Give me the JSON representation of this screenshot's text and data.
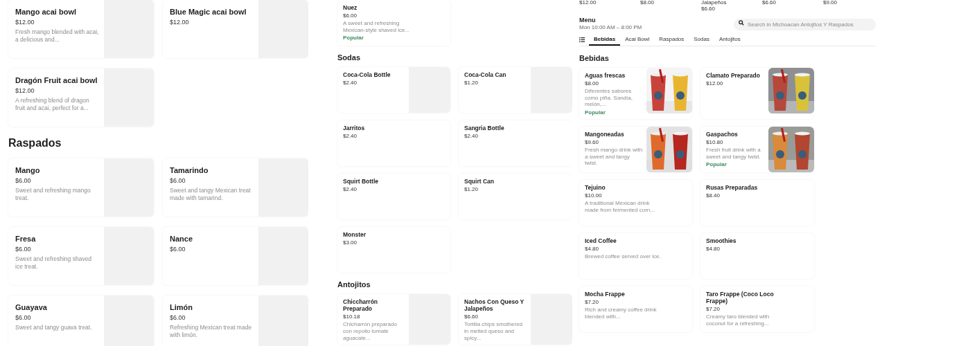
{
  "panels": [
    {
      "sections": [
        {
          "items": [
            {
              "kind": "placeholder",
              "name": "Mango acai bowl",
              "price": "$12.00",
              "description": "Fresh mango blended with acai, a delicious and..."
            },
            {
              "kind": "placeholder",
              "name": "Blue Magic acai bowl",
              "price": "$12.00"
            },
            {
              "kind": "placeholder",
              "name": "Dragón Fruit acai bowl",
              "price": "$12.00",
              "description": "A refreshing blend of dragon fruit and acai, perfect for a..."
            }
          ]
        },
        {
          "heading": "Raspados",
          "items": [
            {
              "kind": "placeholder",
              "name": "Mango",
              "price": "$6.00",
              "description": "Sweet and refreshing mango treat."
            },
            {
              "kind": "placeholder",
              "name": "Tamarindo",
              "price": "$6.00",
              "description": "Sweet and tangy Mexican treat made with tamarind."
            },
            {
              "kind": "placeholder",
              "name": "Fresa",
              "price": "$6.00",
              "description": "Sweet and refreshing shaved ice treat."
            },
            {
              "kind": "placeholder",
              "name": "Nance",
              "price": "$6.00"
            },
            {
              "kind": "placeholder",
              "name": "Guayava",
              "price": "$6.00",
              "description": "Sweet and tangy guava treat."
            },
            {
              "kind": "placeholder",
              "name": "Limón",
              "price": "$6.00",
              "description": "Refreshing Mexican treat made with limón."
            }
          ]
        }
      ]
    },
    {
      "sections": [
        {
          "items": [
            {
              "kind": "plain",
              "name": "Nuez",
              "price": "$6.00",
              "description": "A sweet and refreshing Mexican-style shaved ice...",
              "badge": "Popular"
            }
          ]
        },
        {
          "heading": "Sodas",
          "items": [
            {
              "kind": "placeholder",
              "name": "Coca-Cola Bottle",
              "price": "$2.40"
            },
            {
              "kind": "placeholder",
              "name": "Coca-Cola Can",
              "price": "$1.20"
            },
            {
              "kind": "plain",
              "name": "Jarritos",
              "price": "$2.40"
            },
            {
              "kind": "plain",
              "name": "Sangria Bottle",
              "price": "$2.40"
            },
            {
              "kind": "plain",
              "name": "Squirt Bottle",
              "price": "$2.40"
            },
            {
              "kind": "plain",
              "name": "Squirt Can",
              "price": "$1.20"
            },
            {
              "kind": "plain",
              "name": "Monster",
              "price": "$3.00"
            }
          ]
        },
        {
          "heading": "Antojitos",
          "items": [
            {
              "kind": "placeholder",
              "name": "Chiccharrón Preparado",
              "price": "$10.18",
              "description": "Chicharrón preparado con repollo tomate aguacate..."
            },
            {
              "kind": "placeholder",
              "name": "Nachos Con Queso Y Jalapeños",
              "price": "$6.60",
              "description": "Tortilla chips smothered in melted queso and spicy..."
            }
          ]
        }
      ]
    },
    {
      "top_strip": [
        [
          "$12.00"
        ],
        [
          "$8.00"
        ],
        [
          "Jalapeños",
          "$6.60"
        ],
        [
          "$6.60"
        ],
        [
          "$9.00"
        ]
      ],
      "menu": {
        "title": "Menu",
        "hours": "Mon 10:00 AM – 8:00 PM"
      },
      "search": {
        "placeholder": "Search in Michoacan Antojitos Y Raspados"
      },
      "tabs": [
        {
          "label": "Bebidas",
          "selected": true
        },
        {
          "label": "Acai Bowl",
          "selected": false
        },
        {
          "label": "Raspados",
          "selected": false
        },
        {
          "label": "Sodas",
          "selected": false
        },
        {
          "label": "Antojitos",
          "selected": false
        }
      ],
      "sections": [
        {
          "heading": "Bebidas",
          "items": [
            {
              "kind": "picture",
              "name": "Aguas frescas",
              "price": "$8.00",
              "description": "Diferentes sabores como piña. Sandía, melón,...",
              "badge": "Popular"
            },
            {
              "kind": "picture",
              "name": "Clamato Preparado",
              "price": "$12.00"
            },
            {
              "kind": "picture",
              "name": "Mangoneadas",
              "price": "$9.60",
              "description": "Fresh mango drink with a sweet and tangy twist."
            },
            {
              "kind": "picture",
              "name": "Gaspachos",
              "price": "$10.80",
              "description": "Fresh fruit drink with a sweet and tangy twist.",
              "badge": "Popular"
            },
            {
              "kind": "plain",
              "name": "Tejuino",
              "price": "$10.00",
              "description": "A traditional Mexican drink made from fermented corn..."
            },
            {
              "kind": "plain",
              "name": "Rusas Preparadas",
              "price": "$8.40"
            },
            {
              "kind": "plain",
              "name": "Iced Coffee",
              "price": "$4.80",
              "description": "Brewed coffee served over ice."
            },
            {
              "kind": "plain",
              "name": "Smoothies",
              "price": "$4.80"
            },
            {
              "kind": "plain",
              "name": "Mocha Frappe",
              "price": "$7.20",
              "description": "Rich and creamy coffee drink blended with..."
            },
            {
              "kind": "plain",
              "name": "Taro Frappe (Coco Loco Frappe)",
              "price": "$7.20",
              "description": "Creamy taro blended with coconut for a refreshing..."
            }
          ]
        }
      ]
    }
  ]
}
